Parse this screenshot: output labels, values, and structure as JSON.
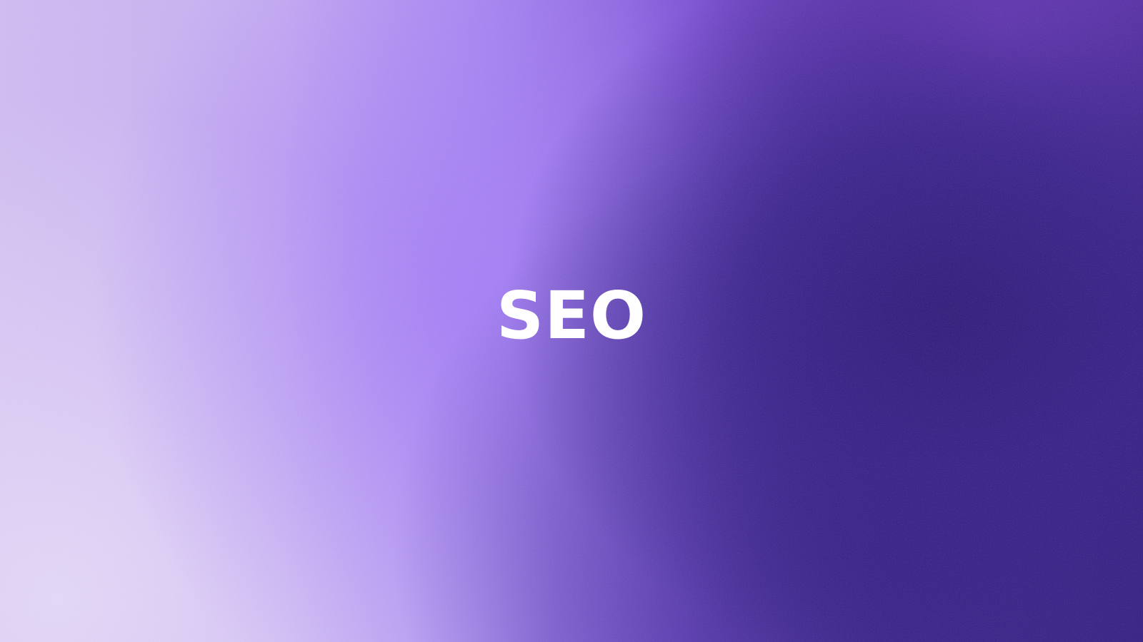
{
  "banner": {
    "title": "SEO",
    "text_color": "#ffffff",
    "gradient_colors": {
      "light_lavender": "#d2bcf5",
      "mid_purple": "#a887f4",
      "violet": "#7b4fd8",
      "deep_indigo": "#301a80"
    }
  }
}
